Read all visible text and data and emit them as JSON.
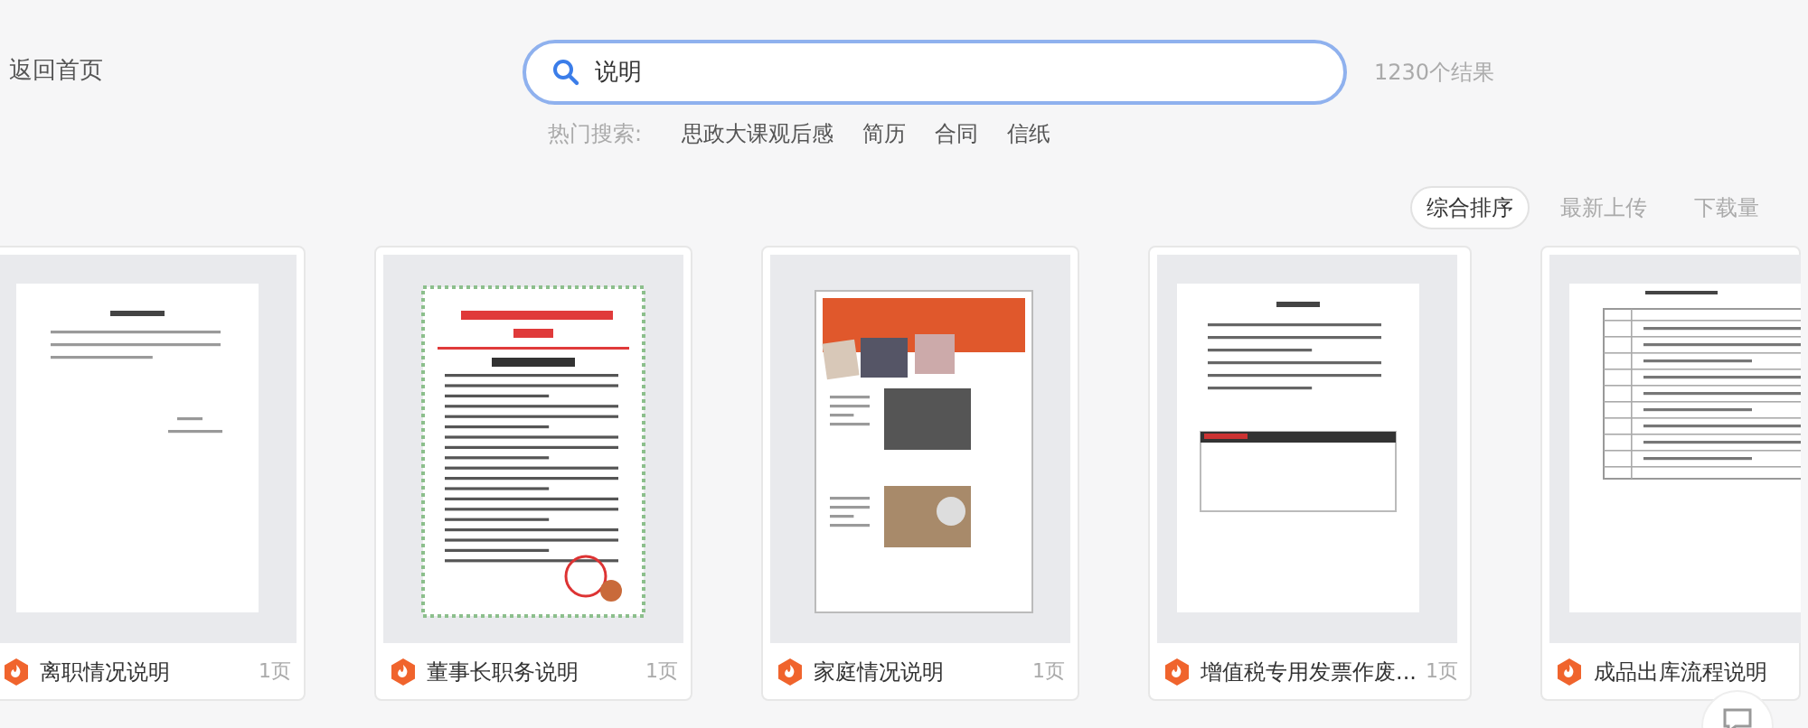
{
  "back_link": "返回首页",
  "search": {
    "value": "说明",
    "result_count": "1230个结果"
  },
  "hot_searches": {
    "label": "热门搜索:",
    "items": [
      "思政大课观后感",
      "简历",
      "合同",
      "信纸"
    ]
  },
  "sort_options": [
    {
      "label": "综合排序",
      "selected": true
    },
    {
      "label": "最新上传",
      "selected": false
    },
    {
      "label": "下载量",
      "selected": false
    }
  ],
  "documents": [
    {
      "title": "离职情况说明",
      "pages": "1页",
      "kind": "letter"
    },
    {
      "title": "董事长职务说明",
      "pages": "1页",
      "kind": "letterhead"
    },
    {
      "title": "家庭情况说明",
      "pages": "1页",
      "kind": "brochure"
    },
    {
      "title": "增值税专用发票作废...",
      "pages": "1页",
      "kind": "form"
    },
    {
      "title": "成品出库流程说明",
      "kind": "table"
    }
  ]
}
